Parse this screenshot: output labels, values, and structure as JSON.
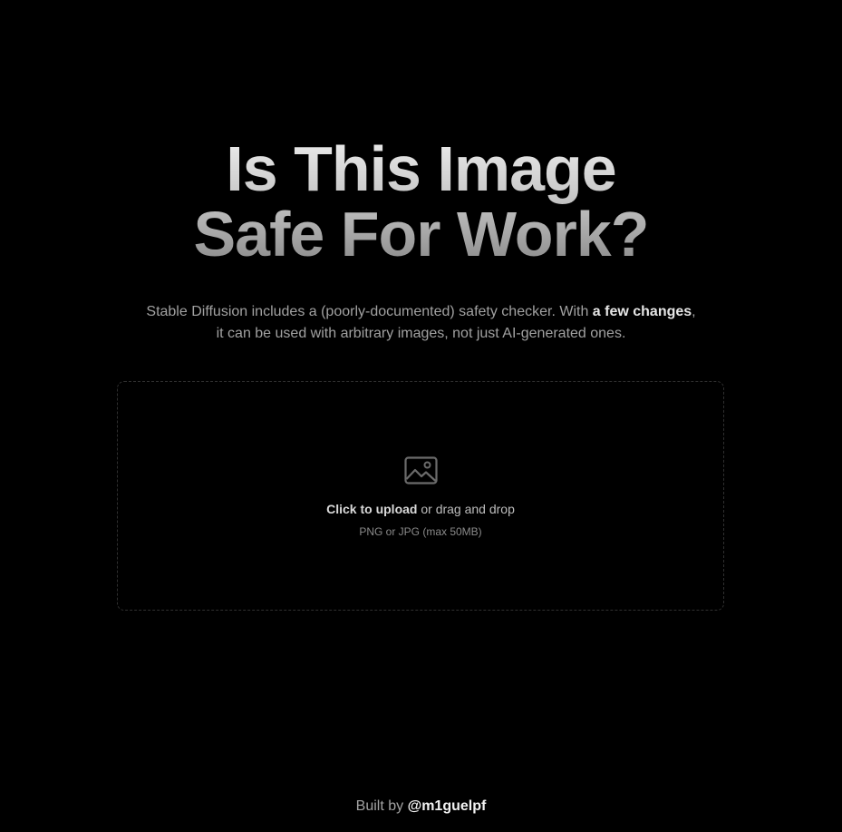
{
  "hero": {
    "title_line1": "Is This Image",
    "title_line2": "Safe For Work?"
  },
  "subtitle": {
    "before_link": "Stable Diffusion includes a (poorly-documented) safety checker. With ",
    "link_text": "a few changes",
    "after_link": ",",
    "line2": "it can be used with arbitrary images, not just AI-generated ones."
  },
  "dropzone": {
    "icon": "image-icon",
    "click_label": "Click to upload",
    "rest_label": " or drag and drop",
    "hint": "PNG or JPG (max 50MB)"
  },
  "footer": {
    "prefix": "Built by ",
    "author": "@m1guelpf"
  },
  "colors": {
    "background": "#000000",
    "dropzone_border": "#2f2f2f",
    "icon": "#6b6b6b"
  }
}
